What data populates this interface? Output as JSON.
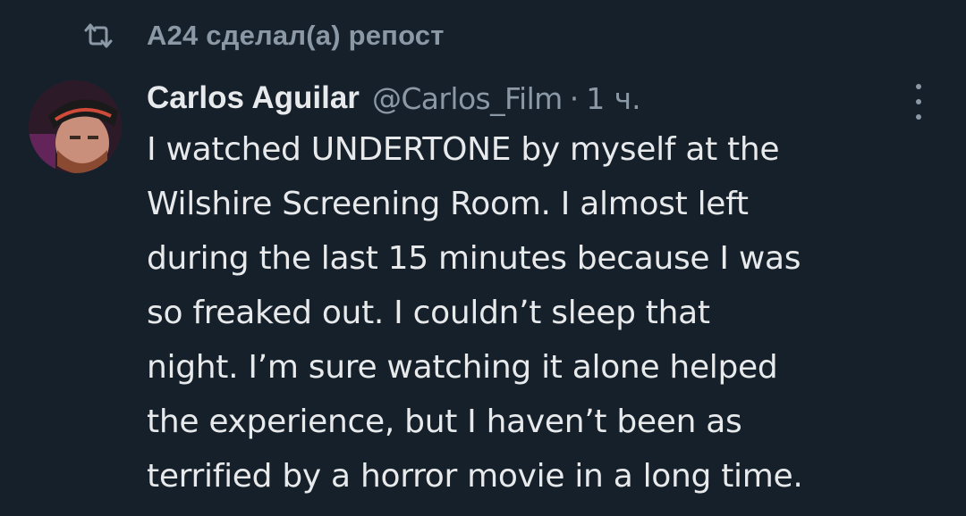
{
  "repost": {
    "icon": "repost-icon",
    "text": "A24 сделал(а) репост"
  },
  "tweet": {
    "author_name": "Carlos Aguilar",
    "handle": "@Carlos_Film",
    "separator": "·",
    "time": "1 ч.",
    "avatar_icon": "avatar",
    "more_icon": "more-vertical-icon",
    "lines": [
      "I watched UNDERTONE by myself at the",
      "Wilshire Screening Room. I almost left",
      "during the last 15 minutes because I was",
      "so freaked out. I couldn’t sleep that",
      "night. I’m sure watching it alone helped",
      "the experience, but I haven’t been as",
      "terrified by a horror movie in a long time."
    ]
  },
  "colors": {
    "background": "#15202b",
    "primary_text": "#e7e9ea",
    "secondary_text": "#8b98a5"
  }
}
